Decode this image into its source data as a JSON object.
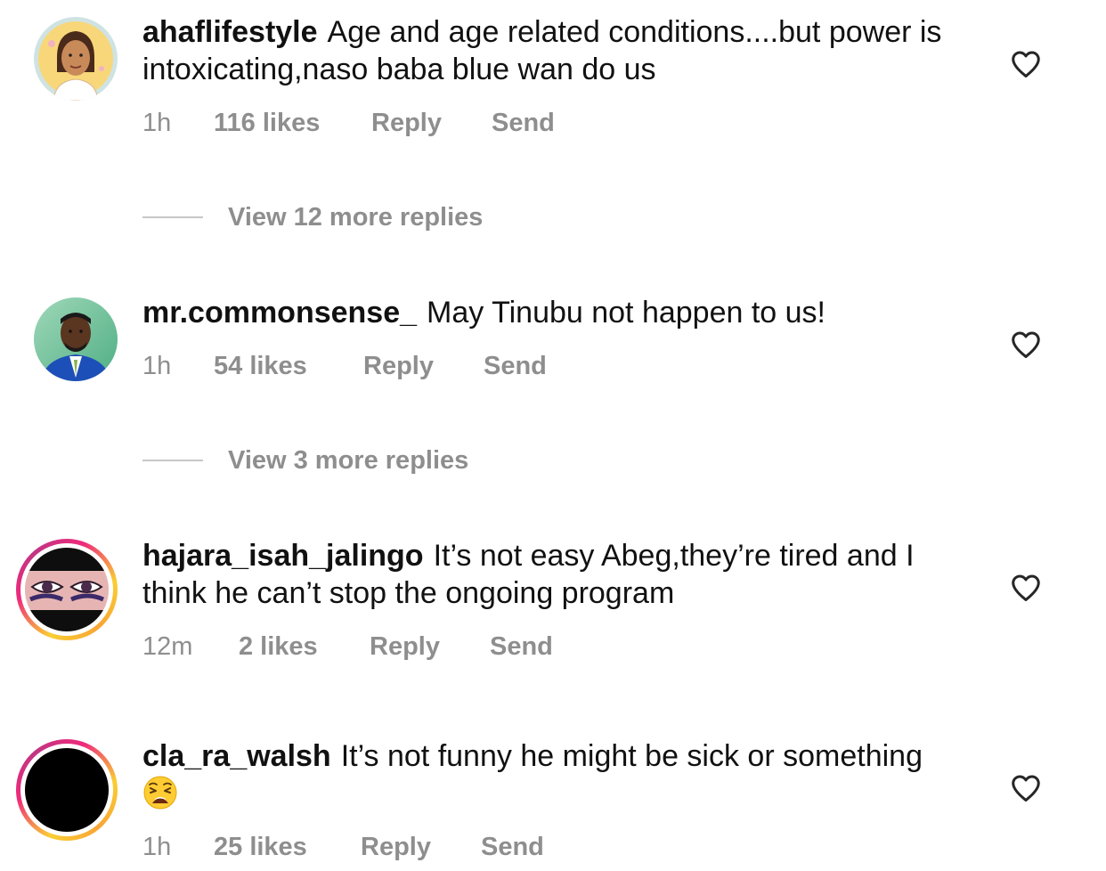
{
  "comments": [
    {
      "username": "ahaflifestyle",
      "text": "Age and age related conditions....but power is intoxicating,naso  baba blue wan do us",
      "time": "1h",
      "likes": "116 likes",
      "reply": "Reply",
      "send": "Send",
      "view_replies": "View 12 more replies"
    },
    {
      "username": "mr.commonsense_",
      "text": "May Tinubu not happen to us!",
      "time": "1h",
      "likes": "54 likes",
      "reply": "Reply",
      "send": "Send",
      "view_replies": "View 3 more replies"
    },
    {
      "username": "hajara_isah_jalingo",
      "text": "It’s not easy Abeg,they’re tired and I think he can’t stop the ongoing program",
      "time": "12m",
      "likes": "2 likes",
      "reply": "Reply",
      "send": "Send"
    },
    {
      "username": "cla_ra_walsh",
      "text": "It’s not funny he might be sick or something",
      "emoji": "weary-face",
      "time": "1h",
      "likes": "25 likes",
      "reply": "Reply",
      "send": "Send"
    }
  ],
  "icons": {
    "like": "heart-outline-icon",
    "story_ring": "gradient-ring"
  },
  "colors": {
    "primary_text": "#111111",
    "secondary_text": "#8e8e8e",
    "divider": "#c7c7c7",
    "ring_yellow": "#f9ce34",
    "ring_pink": "#ee2a7b"
  }
}
